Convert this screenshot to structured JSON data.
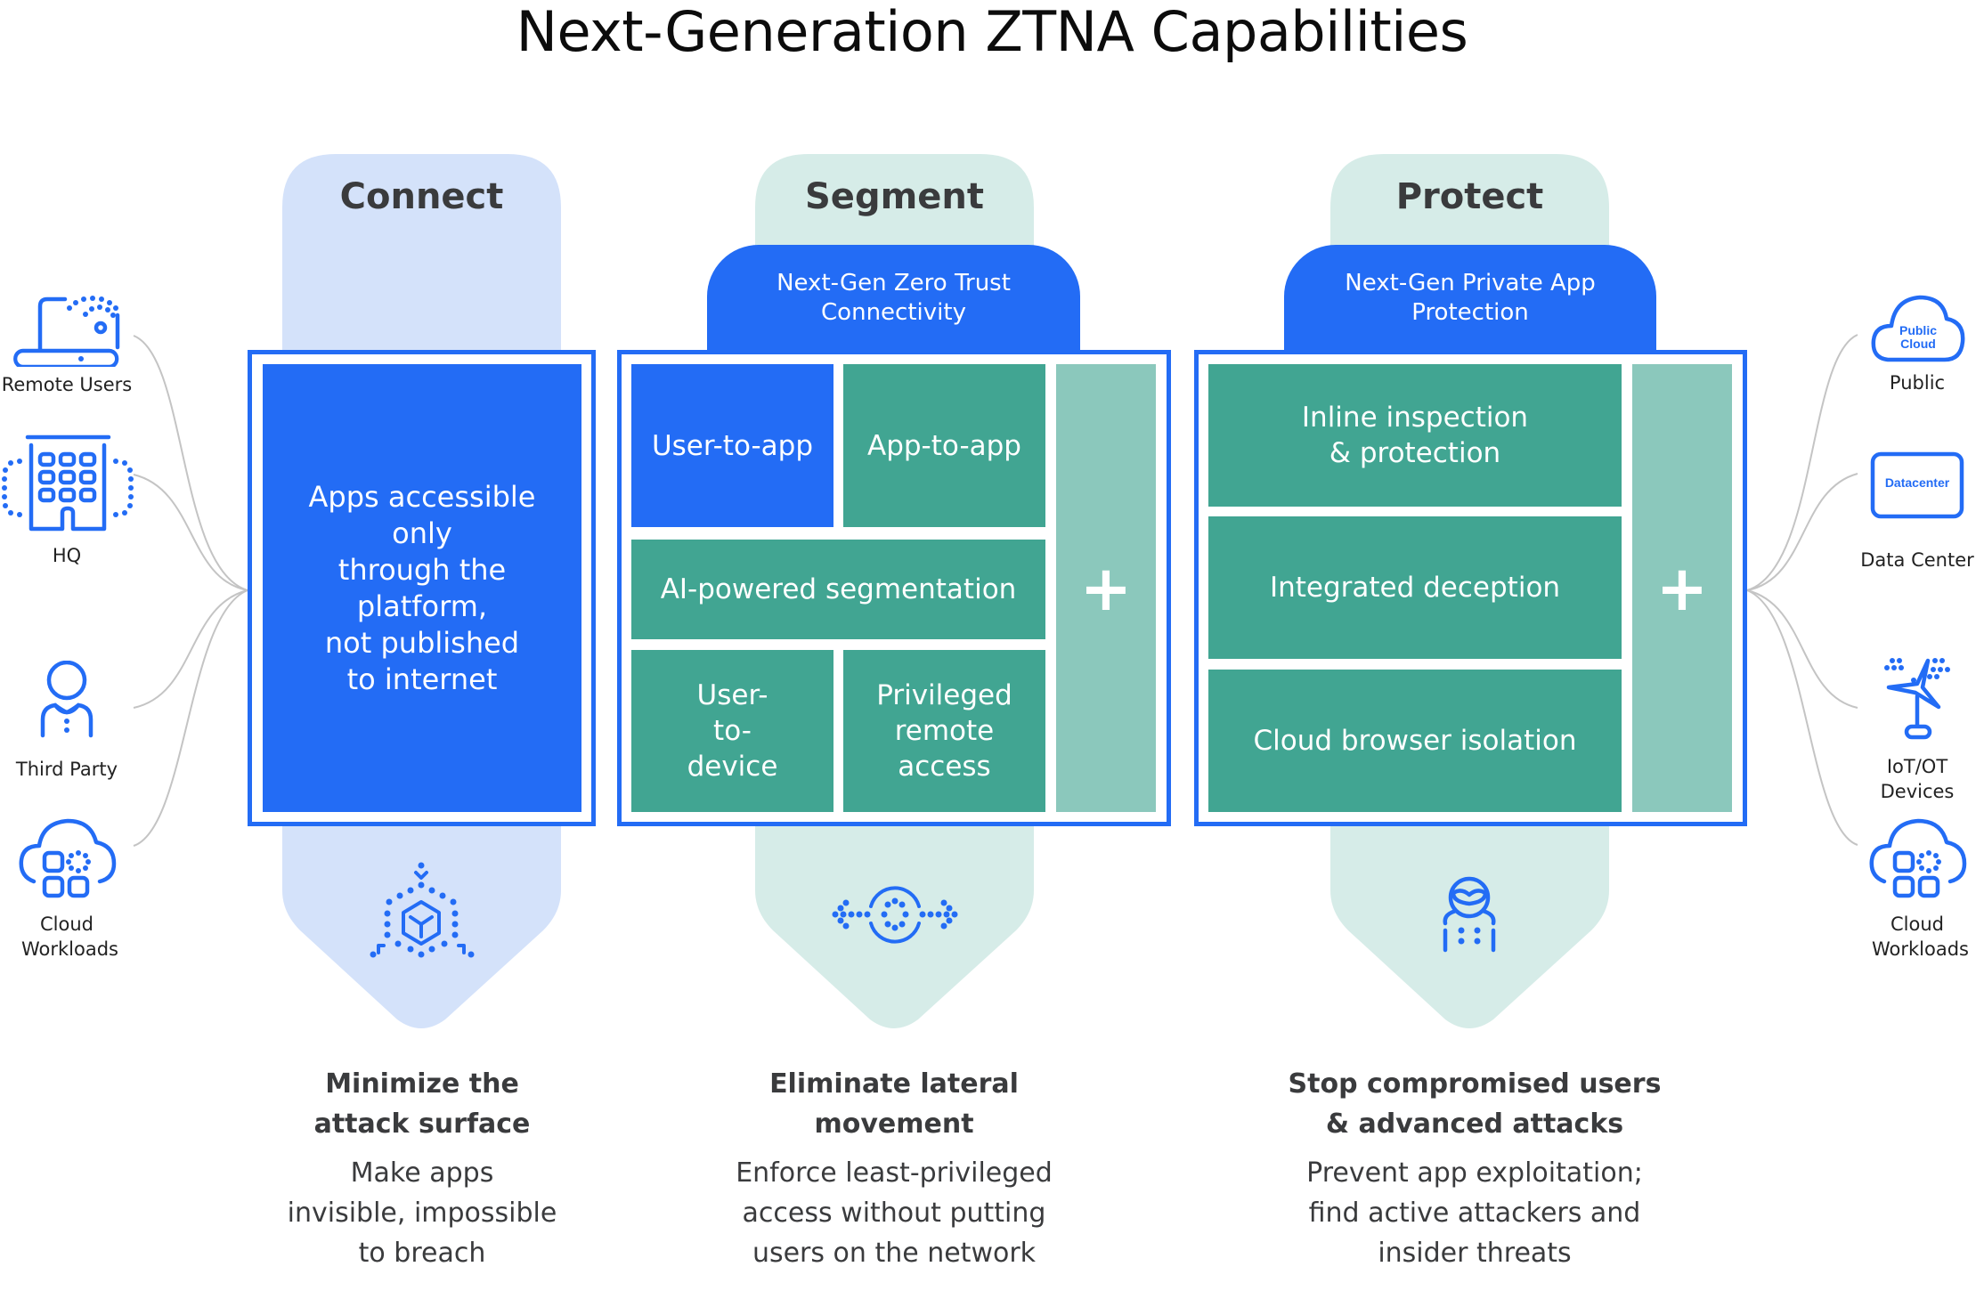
{
  "title": "Next-Generation ZTNA Capabilities",
  "colors": {
    "brand_blue": "#236cf5",
    "teal": "#41a592",
    "light_teal": "#8bc8bc",
    "connect_bg": "#d4e2fa",
    "segment_protect_bg": "#d6ece8",
    "connector_gray": "#c4c4c4"
  },
  "left_sources": [
    {
      "label": "Remote Users",
      "icon": "laptop-wifi-icon"
    },
    {
      "label": "HQ",
      "icon": "office-building-icon"
    },
    {
      "label": "Third Party",
      "icon": "person-icon"
    },
    {
      "label": "Cloud Workloads",
      "icon": "cloud-workloads-icon"
    }
  ],
  "right_sources": [
    {
      "label": "Public",
      "icon": "public-cloud-icon",
      "icon_text": "Public Cloud"
    },
    {
      "label": "Data Center",
      "icon": "datacenter-icon",
      "icon_text": "Datacenter"
    },
    {
      "label": "IoT/OT Devices",
      "icon": "iot-windmill-icon"
    },
    {
      "label": "Cloud Workloads",
      "icon": "cloud-workloads-icon"
    }
  ],
  "columns": {
    "connect": {
      "heading": "Connect",
      "cell": "Apps accessible only through the platform, not published to internet",
      "cell_lines": [
        "Apps accessible",
        "only",
        "through the",
        "platform,",
        "not published",
        "to internet"
      ],
      "icon": "hexagon-cube-icon",
      "caption_head": [
        "Minimize the",
        "attack surface"
      ],
      "caption_body": [
        "Make apps",
        "invisible, impossible",
        "to breach"
      ]
    },
    "segment": {
      "heading": "Segment",
      "tab": [
        "Next-Gen Zero Trust",
        "Connectivity"
      ],
      "cells": {
        "user_to_app": "User-to-app",
        "app_to_app": "App-to-app",
        "ai_segmentation": "AI-powered segmentation",
        "user_to_device": [
          "User-",
          "to-",
          "device"
        ],
        "privileged_remote": [
          "Privileged",
          "remote",
          "access"
        ],
        "plus": "+"
      },
      "icon": "lateral-movement-icon",
      "caption_head": [
        "Eliminate lateral",
        "movement"
      ],
      "caption_body": [
        "Enforce least-privileged",
        "access without putting",
        "users on the network"
      ]
    },
    "protect": {
      "heading": "Protect",
      "tab": [
        "Next-Gen Private App",
        "Protection"
      ],
      "cells": {
        "inline_inspection": [
          "Inline inspection",
          "& protection"
        ],
        "deception": "Integrated deception",
        "browser_isolation": "Cloud browser isolation",
        "plus": "+"
      },
      "icon": "attacker-icon",
      "caption_head": [
        "Stop compromised users",
        "& advanced attacks"
      ],
      "caption_body": [
        "Prevent app exploitation;",
        "find active attackers and",
        "insider threats"
      ]
    }
  }
}
